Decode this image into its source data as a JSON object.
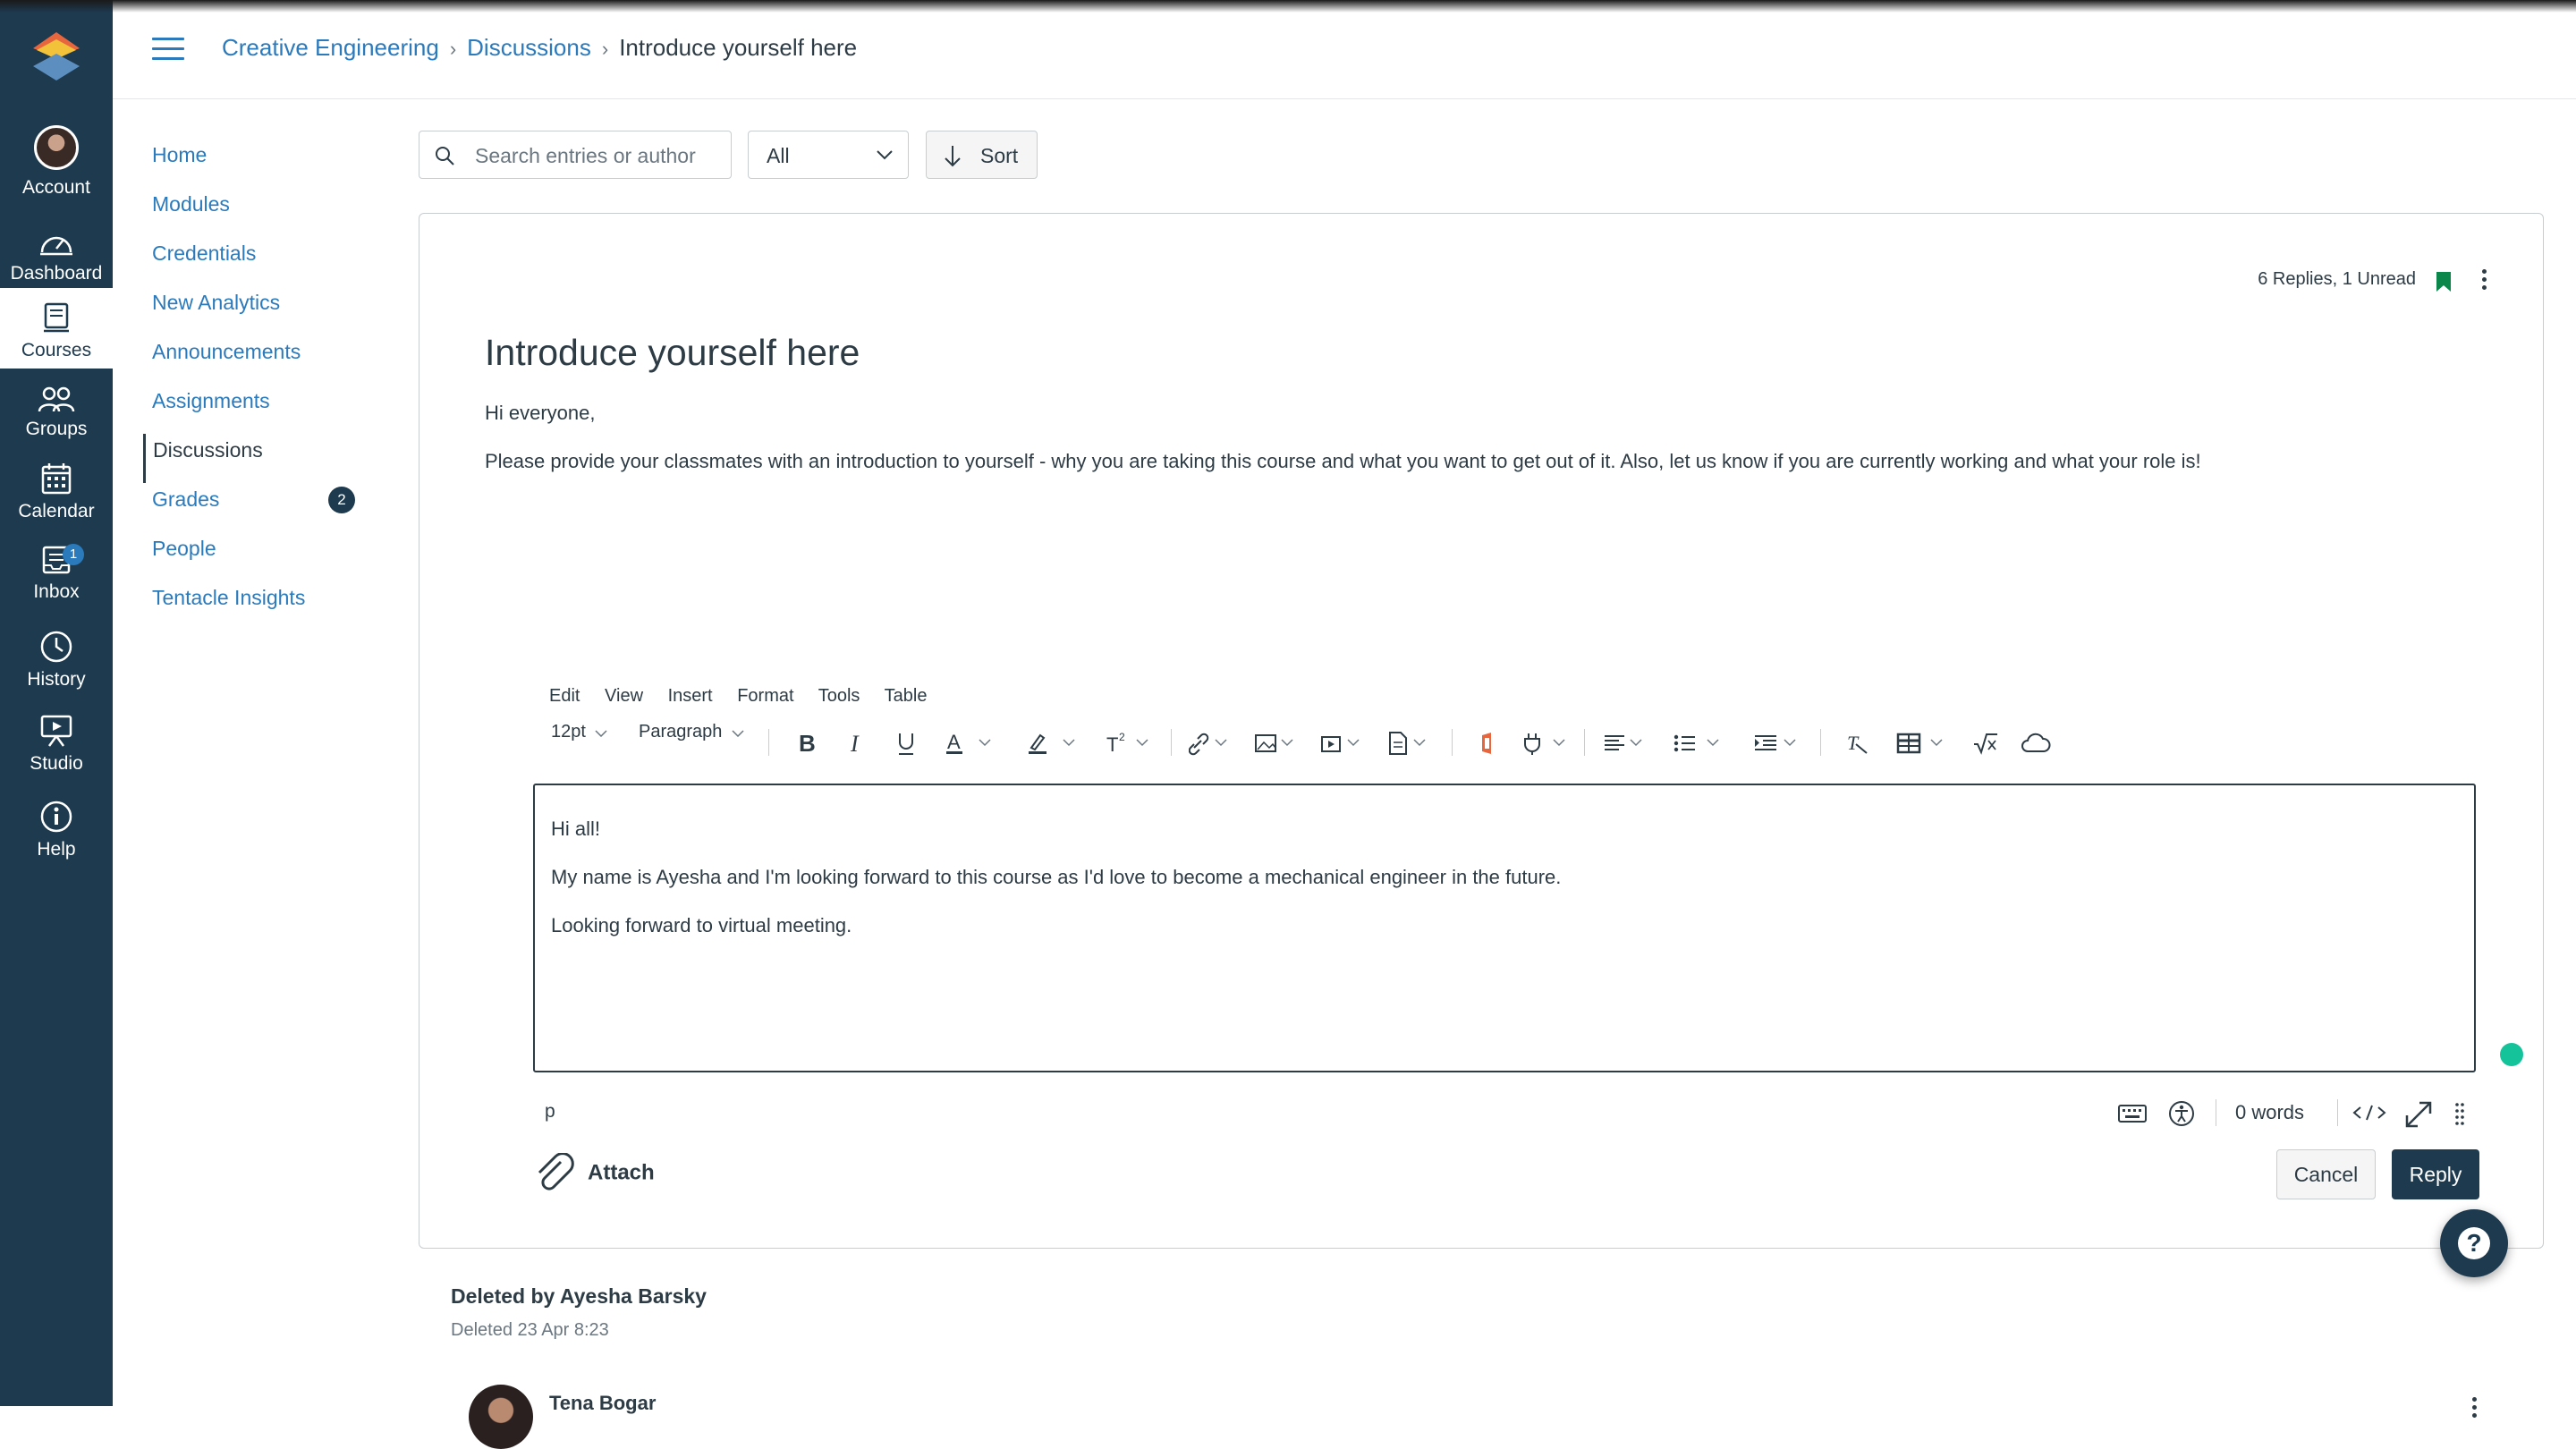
{
  "colors": {
    "nav_bg": "#1e3a4f",
    "link": "#2b7abc",
    "text": "#2d3b45",
    "bookmark": "#0b874b",
    "reply_btn": "#1e3a4f"
  },
  "global_nav": {
    "items": [
      {
        "label": "Account",
        "icon": "avatar"
      },
      {
        "label": "Dashboard",
        "icon": "dashboard-icon"
      },
      {
        "label": "Courses",
        "icon": "courses-icon"
      },
      {
        "label": "Groups",
        "icon": "groups-icon"
      },
      {
        "label": "Calendar",
        "icon": "calendar-icon"
      },
      {
        "label": "Inbox",
        "icon": "inbox-icon",
        "badge": "1"
      },
      {
        "label": "History",
        "icon": "history-icon"
      },
      {
        "label": "Studio",
        "icon": "studio-icon"
      },
      {
        "label": "Help",
        "icon": "help-icon"
      }
    ]
  },
  "header": {
    "breadcrumb": [
      "Creative Engineering",
      "Discussions",
      "Introduce yourself here"
    ]
  },
  "course_nav": {
    "items": [
      {
        "label": "Home"
      },
      {
        "label": "Modules"
      },
      {
        "label": "Credentials"
      },
      {
        "label": "New Analytics"
      },
      {
        "label": "Announcements"
      },
      {
        "label": "Assignments"
      },
      {
        "label": "Discussions"
      },
      {
        "label": "Grades",
        "count": "2"
      },
      {
        "label": "People"
      },
      {
        "label": "Tentacle Insights"
      }
    ]
  },
  "toolbar": {
    "search_placeholder": "Search entries or author",
    "filter_value": "All",
    "sort_label": "Sort"
  },
  "topic": {
    "meta": "6 Replies, 1 Unread",
    "title": "Introduce yourself here",
    "greeting": "Hi everyone,",
    "body": "Please provide your classmates with an introduction to yourself - why you are taking this course and what you want to get out of it. Also, let us know if you are currently working and what your role is!"
  },
  "editor": {
    "menus": [
      "Edit",
      "View",
      "Insert",
      "Format",
      "Tools",
      "Table"
    ],
    "font_size": "12pt",
    "block_format": "Paragraph",
    "content": [
      "Hi all!",
      "My name is Ayesha and I'm looking forward to this course as I'd love to become a mechanical engineer in the future.",
      "Looking forward to virtual meeting."
    ],
    "path": "p",
    "word_count": "0 words",
    "attach_label": "Attach",
    "cancel_label": "Cancel",
    "reply_label": "Reply"
  },
  "entries": {
    "deleted_by": "Deleted by Ayesha Barsky",
    "deleted_at": "Deleted 23 Apr 8:23",
    "next_author": "Tena Bogar"
  }
}
